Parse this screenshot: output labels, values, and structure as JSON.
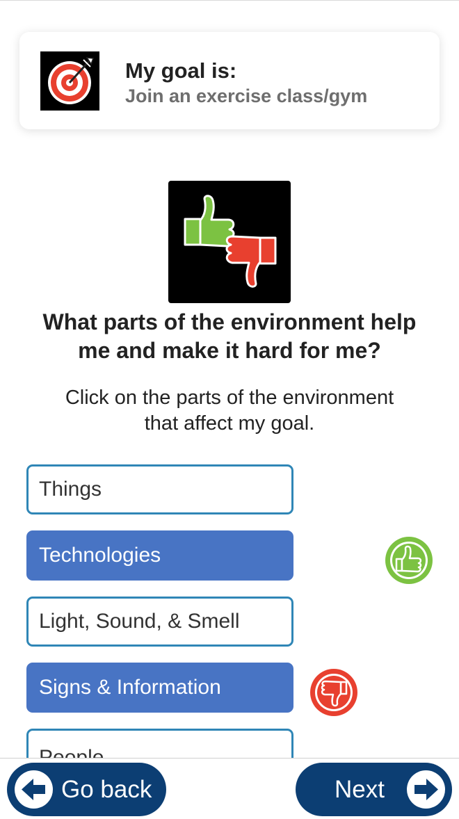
{
  "goal": {
    "title": "My goal is:",
    "text": "Join an exercise class/gym",
    "icon": "target-icon"
  },
  "hero_icon": "thumbs-up-down-icon",
  "question": {
    "line1": "What parts of the environment help",
    "line2": "me and make it hard for me?"
  },
  "instruction": {
    "line1": "Click on the parts of the environment",
    "line2": "that affect my goal."
  },
  "options": [
    {
      "label": "Things",
      "selected": false,
      "rating": ""
    },
    {
      "label": "Technologies",
      "selected": true,
      "rating": "helps"
    },
    {
      "label": "Light, Sound, & Smell",
      "selected": false,
      "rating": ""
    },
    {
      "label": "Signs & Information",
      "selected": true,
      "rating": "hard"
    },
    {
      "label": "People",
      "selected": false,
      "rating": ""
    }
  ],
  "colors": {
    "selected": "#4874c4",
    "border": "#2f86b6",
    "thumb_up": "#7cc242",
    "thumb_down": "#e8402f",
    "button": "#0c3e73"
  },
  "footer": {
    "back_label": "Go back",
    "next_label": "Next"
  }
}
